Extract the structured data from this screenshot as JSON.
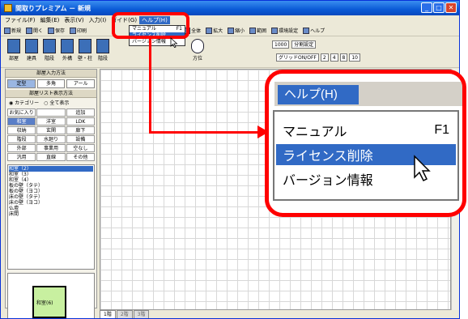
{
  "window": {
    "title": "間取りプレミアム － 新規",
    "buttons": [
      "_",
      "□",
      "✕"
    ]
  },
  "menubar": {
    "items": [
      "ファイル(F)",
      "編集(E)",
      "表示(V)",
      "入力(I)",
      "ガイド(G)",
      "ヘルプ(H)"
    ],
    "active_index": 5
  },
  "toolbar1": {
    "items": [
      "新規",
      "開く",
      "保存",
      "印刷",
      "戻る",
      "進む",
      "全体",
      "拡大",
      "縮小",
      "範囲",
      "環境設定",
      "ヘルプ"
    ]
  },
  "toolbar2": {
    "tools": [
      "部屋",
      "建具",
      "階段",
      "外構",
      "壁・柱",
      "階段",
      "方位"
    ],
    "grid_scale": "1000",
    "grid_setting_label": "分割設定",
    "grid_toggle_label": "グリッドON/OFF",
    "grid_values": [
      "2",
      "4",
      "8",
      "10"
    ]
  },
  "left_panel": {
    "input_method_title": "部屋入力方法",
    "mode_buttons": [
      "定型",
      "多角",
      "アール"
    ],
    "list_title": "部屋リスト表示方法",
    "radio_category": "カテゴリー",
    "radio_all": "全て表示",
    "categories": [
      "お気に入り",
      "",
      "追加",
      "和室",
      "洋室",
      "LDK",
      "収納",
      "玄関",
      "廊下",
      "階段",
      "水廻り",
      "設備",
      "外部",
      "事業用",
      "空なし",
      "汎用",
      "直線",
      "その他"
    ],
    "selected_category_index": 3,
    "rooms": [
      "和室（2）",
      "和室（3）",
      "和室（4）",
      "板の壁（タテ）",
      "板の壁（ヨコ）",
      "床の壁（タテ）",
      "床の壁（ヨコ）",
      "仏壇",
      "床間"
    ],
    "selected_room_index": 0,
    "preview_label": "和室(6)"
  },
  "floor_tabs": [
    "1階",
    "2階",
    "3階"
  ],
  "help_menu_small": {
    "items": [
      {
        "label": "マニュアル",
        "shortcut": "F1"
      },
      {
        "label": "ライセンス削除",
        "shortcut": ""
      },
      {
        "label": "バージョン情報",
        "shortcut": ""
      }
    ],
    "highlighted_index": 1
  },
  "callout": {
    "menu_label": "ヘルプ(H)",
    "items": [
      {
        "label": "マニュアル",
        "shortcut": "F1"
      },
      {
        "label": "ライセンス削除",
        "shortcut": ""
      },
      {
        "label": "バージョン情報",
        "shortcut": ""
      }
    ],
    "highlighted_index": 1
  },
  "colors": {
    "highlight": "#316ac5",
    "annotation": "#ff0000",
    "title_bar": "#0a5ad6"
  }
}
